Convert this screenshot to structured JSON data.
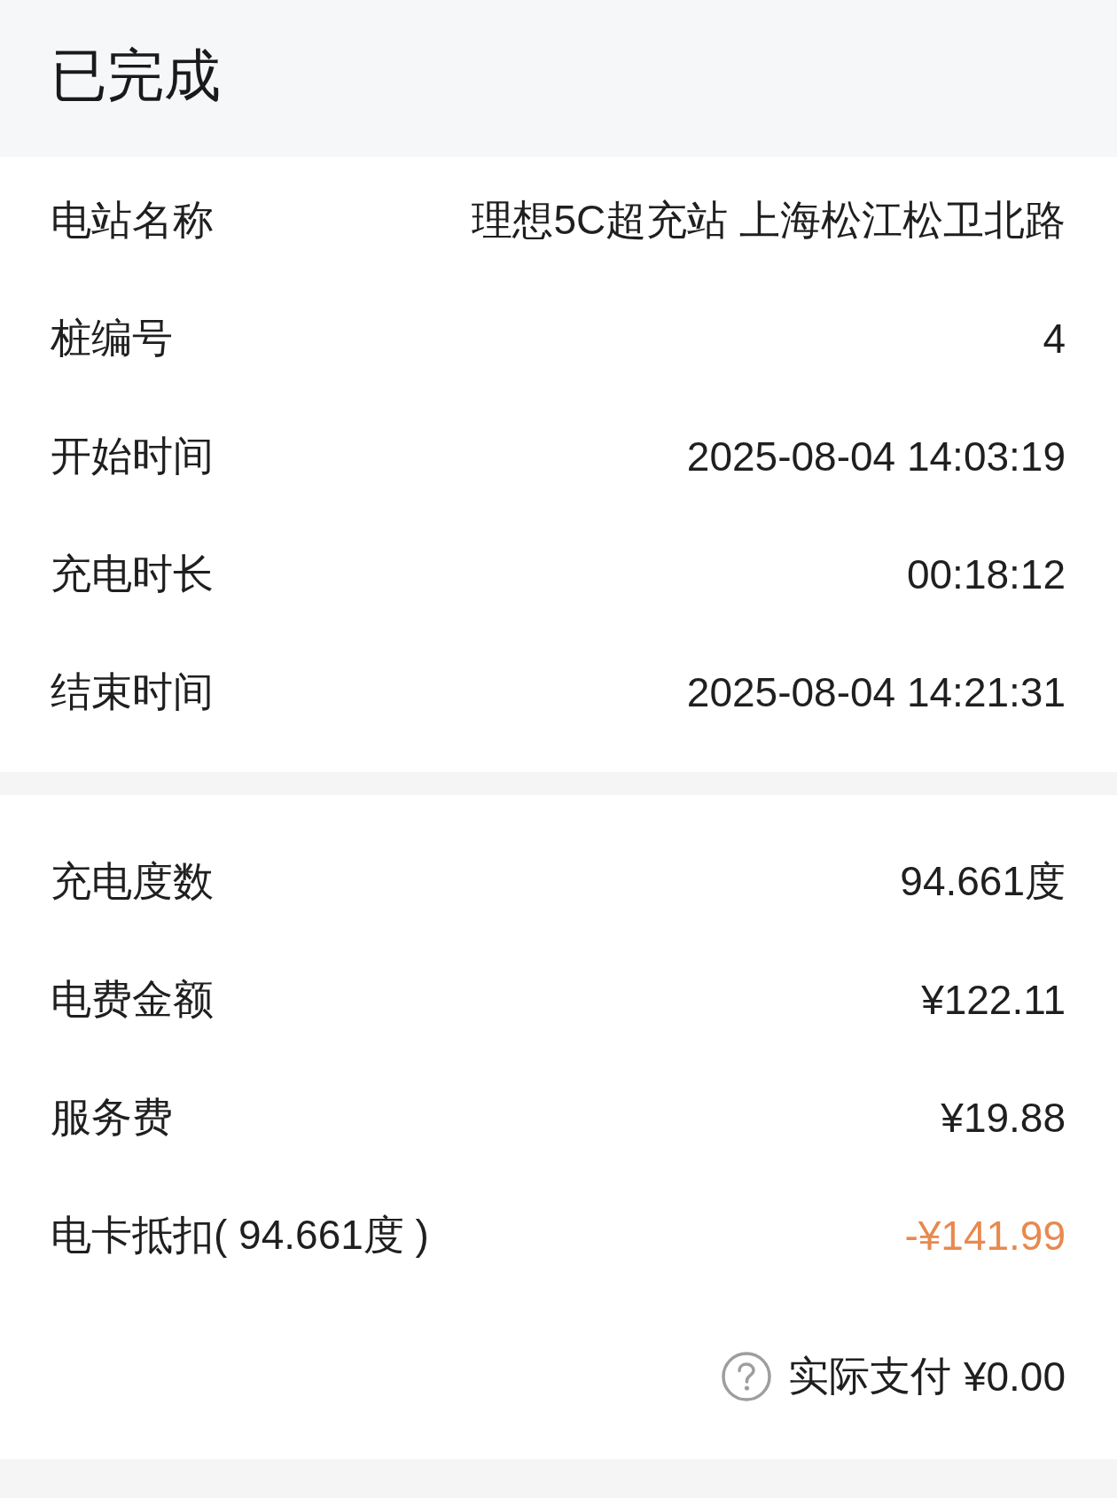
{
  "header": {
    "title": "已完成"
  },
  "sections": [
    {
      "rows": [
        {
          "kind": "plain",
          "label": "电站名称",
          "value": "理想5C超充站 上海松江松卫北路"
        },
        {
          "kind": "plain",
          "label": "桩编号",
          "value": "4"
        },
        {
          "kind": "plain",
          "label": "开始时间",
          "value": "2025-08-04 14:03:19"
        },
        {
          "kind": "plain",
          "label": "充电时长",
          "value": "00:18:12"
        },
        {
          "kind": "plain",
          "label": "结束时间",
          "value": "2025-08-04 14:21:31"
        }
      ]
    },
    {
      "rows": [
        {
          "kind": "plain",
          "label": "充电度数",
          "value": "94.661度"
        },
        {
          "kind": "plain",
          "label": "电费金额",
          "value": "¥122.11"
        },
        {
          "kind": "plain",
          "label": "服务费",
          "value": "¥19.88"
        },
        {
          "kind": "discount",
          "label": "电卡抵扣( 94.661度 )",
          "value": "-¥141.99"
        }
      ]
    }
  ],
  "total": {
    "label": "实际支付",
    "value": "¥0.00"
  }
}
